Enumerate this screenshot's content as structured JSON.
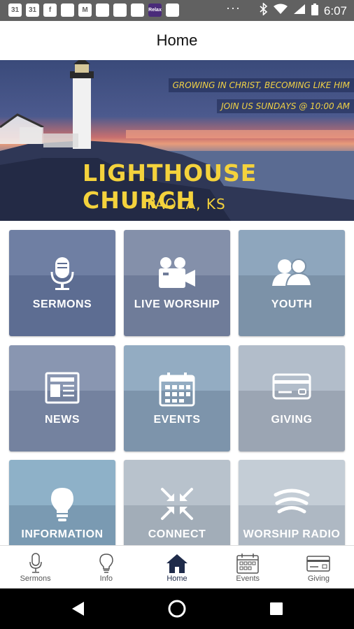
{
  "status_bar": {
    "time": "6:07",
    "notif_icons": [
      "31",
      "31",
      "f",
      "",
      "M",
      "",
      "",
      "",
      "Relax",
      ""
    ],
    "more": "···"
  },
  "app_bar": {
    "title": "Home"
  },
  "banner": {
    "tagline_1": "GROWING IN CHRIST, BECOMING LIKE HIM",
    "tagline_2": "JOIN US SUNDAYS @ 10:00 AM",
    "church_name": "LIGHTHOUSE CHURCH",
    "location": "PAOLA, KS"
  },
  "tiles": [
    {
      "label": "SERMONS",
      "icon": "microphone-icon",
      "top_color": "#6f7fa3",
      "bottom_color": "#5d6d92"
    },
    {
      "label": "LIVE WORSHIP",
      "icon": "video-camera-icon",
      "top_color": "#8490aa",
      "bottom_color": "#6f7c99"
    },
    {
      "label": "YOUTH",
      "icon": "people-icon",
      "top_color": "#8ea6bd",
      "bottom_color": "#7c92a8"
    },
    {
      "label": "NEWS",
      "icon": "newspaper-icon",
      "top_color": "#8996b1",
      "bottom_color": "#74829f"
    },
    {
      "label": "EVENTS",
      "icon": "calendar-icon",
      "top_color": "#93acc2",
      "bottom_color": "#7d94ab"
    },
    {
      "label": "GIVING",
      "icon": "credit-card-icon",
      "top_color": "#b2bdca",
      "bottom_color": "#9ba5b3"
    },
    {
      "label": "INFORMATION",
      "icon": "lightbulb-icon",
      "top_color": "#8eb1c8",
      "bottom_color": "#7a9ab2"
    },
    {
      "label": "CONNECT",
      "icon": "arrows-in-icon",
      "top_color": "#b8c2cc",
      "bottom_color": "#a2adb8"
    },
    {
      "label": "WORSHIP RADIO",
      "icon": "radio-waves-icon",
      "top_color": "#c4cdd6",
      "bottom_color": "#aeb8c3"
    }
  ],
  "bottom_nav": [
    {
      "label": "Sermons",
      "icon": "microphone-icon",
      "active": false
    },
    {
      "label": "Info",
      "icon": "lightbulb-icon",
      "active": false
    },
    {
      "label": "Home",
      "icon": "home-icon",
      "active": true
    },
    {
      "label": "Events",
      "icon": "calendar-icon",
      "active": false
    },
    {
      "label": "Giving",
      "icon": "credit-card-icon",
      "active": false
    }
  ],
  "system_nav": {
    "buttons": [
      "back",
      "home",
      "recents"
    ]
  }
}
